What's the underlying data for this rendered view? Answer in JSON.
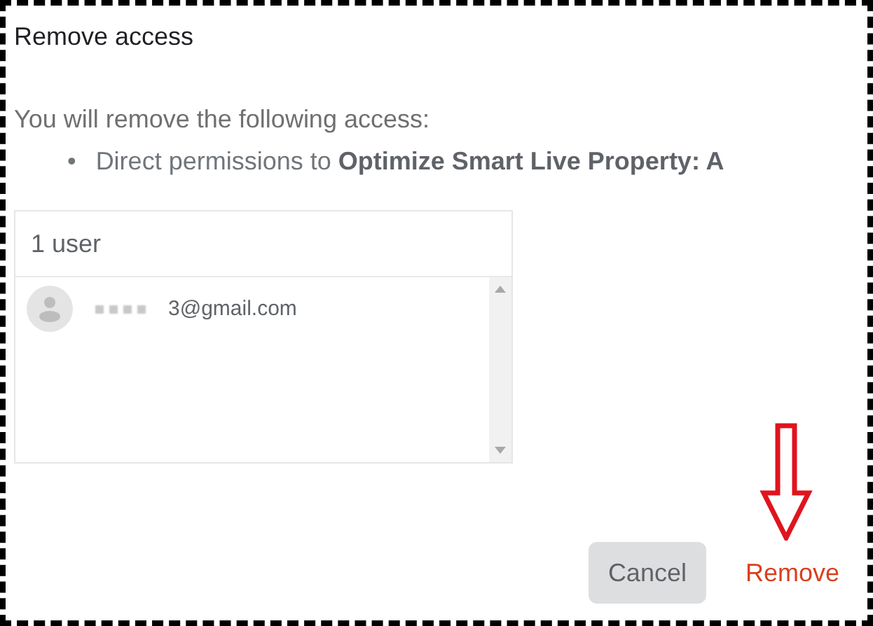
{
  "dialog": {
    "title": "Remove access",
    "intro": "You will remove the following access:",
    "bullets": [
      {
        "marker": "•",
        "text": "Direct permissions to **Optimize Smart Live Property: A**"
      }
    ]
  },
  "users": {
    "header": "1 user",
    "items": [
      {
        "email": "3@gmail.com",
        "redacted": true
      }
    ]
  },
  "buttons": [
    {
      "label": "Cancel",
      "kind": "secondary"
    },
    {
      "label": "Remove",
      "kind": "primary"
    }
  ]
}
